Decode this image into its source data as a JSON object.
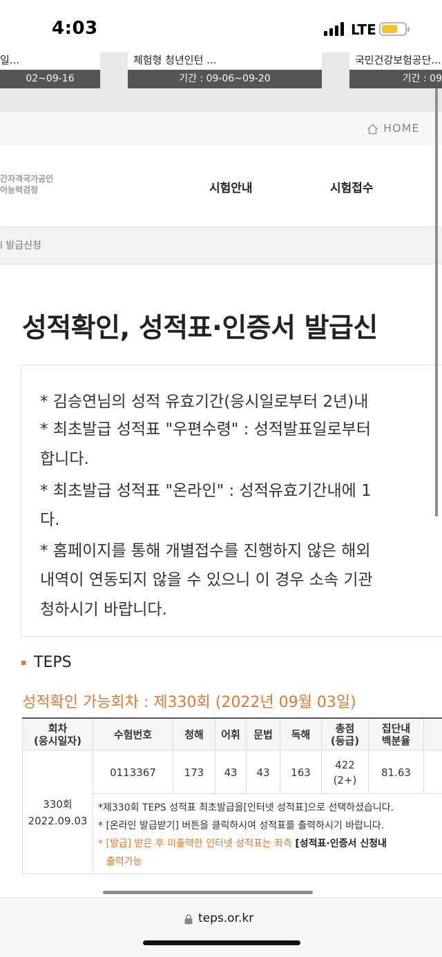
{
  "status": {
    "time": "4:03",
    "network": "LTE"
  },
  "banners": [
    {
      "title": "일...",
      "period": "02~09-16"
    },
    {
      "title": "체험형 청년인턴 ...",
      "period": "기간 : 09-06~09-20"
    },
    {
      "title": "국민건강보험공단...",
      "period": "기간 : 09"
    }
  ],
  "util": {
    "home": "HOME"
  },
  "logo": {
    "line1": "간자격국가공인",
    "line2": "어능력검정"
  },
  "nav": {
    "items": [
      "시험안내",
      "시험접수"
    ]
  },
  "breadcrumb": "l 발급신청",
  "page_title": "성적확인, 성적표·인증서 발급신",
  "notice": {
    "lines": [
      "* 김승연님의 성적 유효기간(응시일로부터 2년)내",
      "* 최초발급 성적표 \"우편수령\" : 성적발표일로부터",
      "합니다.",
      "* 최초발급 성적표 \"온라인\" : 성적유효기간내에 1",
      "다.",
      "* 홈페이지를 통해 개별접수를 진행하지 않은 해외",
      "내역이 연동되지 않을 수 있으니 이 경우 소속 기관",
      "청하시기 바랍니다."
    ]
  },
  "section": {
    "title": "TEPS",
    "available": "성적확인 가능회차 : 제330회 (2022년 09월 03일)"
  },
  "table": {
    "headers": {
      "round": [
        "회차",
        "(응시일자)"
      ],
      "exam_no": "수험번호",
      "listening": "청해",
      "vocab": "어휘",
      "grammar": "문법",
      "reading": "독해",
      "total": [
        "총점",
        "(등급)"
      ],
      "percentile": [
        "집단내",
        "백분율"
      ]
    },
    "row": {
      "round": "330회",
      "date": "2022.09.03",
      "exam_no": "0113367",
      "listening": "173",
      "vocab": "43",
      "grammar": "43",
      "reading": "163",
      "total": "422",
      "grade": "(2+)",
      "percentile": "81.63"
    },
    "notes": {
      "n1": "*제330회 TEPS 성적표 최초발급을[인터넷 성적표]으로 선택하셨습니다.",
      "n2": "* [온라인 발급받기] 버튼을 클릭하시여 성적표를 출력하시기 바랍니다.",
      "n3_star": "* ",
      "n3_orange": "[발급] 받은 후 미출력한 인터넷 성적표는 좌측 ",
      "n3_bold": "[성적표·인증서 신청내",
      "n4": "출력가능"
    }
  },
  "browser": {
    "url": "teps.or.kr"
  }
}
